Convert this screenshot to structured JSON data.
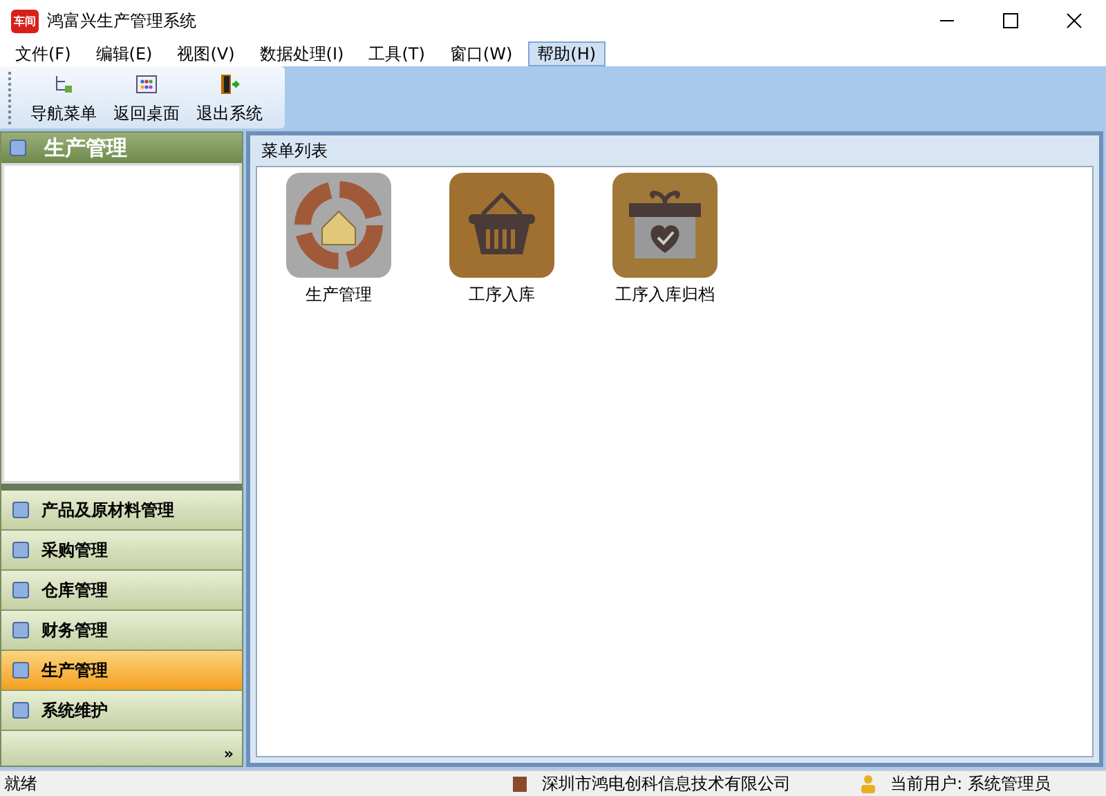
{
  "window": {
    "logo": "车间",
    "title": "鸿富兴生产管理系统"
  },
  "menu": [
    {
      "label": "文件(F)",
      "selected": false
    },
    {
      "label": "编辑(E)",
      "selected": false
    },
    {
      "label": "视图(V)",
      "selected": false
    },
    {
      "label": "数据处理(I)",
      "selected": false
    },
    {
      "label": "工具(T)",
      "selected": false
    },
    {
      "label": "窗口(W)",
      "selected": false
    },
    {
      "label": "帮助(H)",
      "selected": true
    }
  ],
  "toolbar": [
    {
      "label": "导航菜单",
      "kind": "tree"
    },
    {
      "label": "返回桌面",
      "kind": "desktop"
    },
    {
      "label": "退出系统",
      "kind": "exit"
    }
  ],
  "sidebar": {
    "title": "生产管理",
    "items": [
      {
        "label": "产品及原材料管理",
        "selected": false
      },
      {
        "label": "采购管理",
        "selected": false
      },
      {
        "label": "仓库管理",
        "selected": false
      },
      {
        "label": "财务管理",
        "selected": false
      },
      {
        "label": "生产管理",
        "selected": true
      },
      {
        "label": "系统维护",
        "selected": false
      }
    ],
    "more": "»"
  },
  "panel": {
    "title": "菜单列表",
    "tiles": [
      {
        "label": "生产管理",
        "kind": "target"
      },
      {
        "label": "工序入库",
        "kind": "basket"
      },
      {
        "label": "工序入库归档",
        "kind": "gift"
      }
    ]
  },
  "status_bar": {
    "state": "就绪",
    "company": "深圳市鸿电创科信息技术有限公司",
    "user": "当前用户: 系统管理员"
  }
}
